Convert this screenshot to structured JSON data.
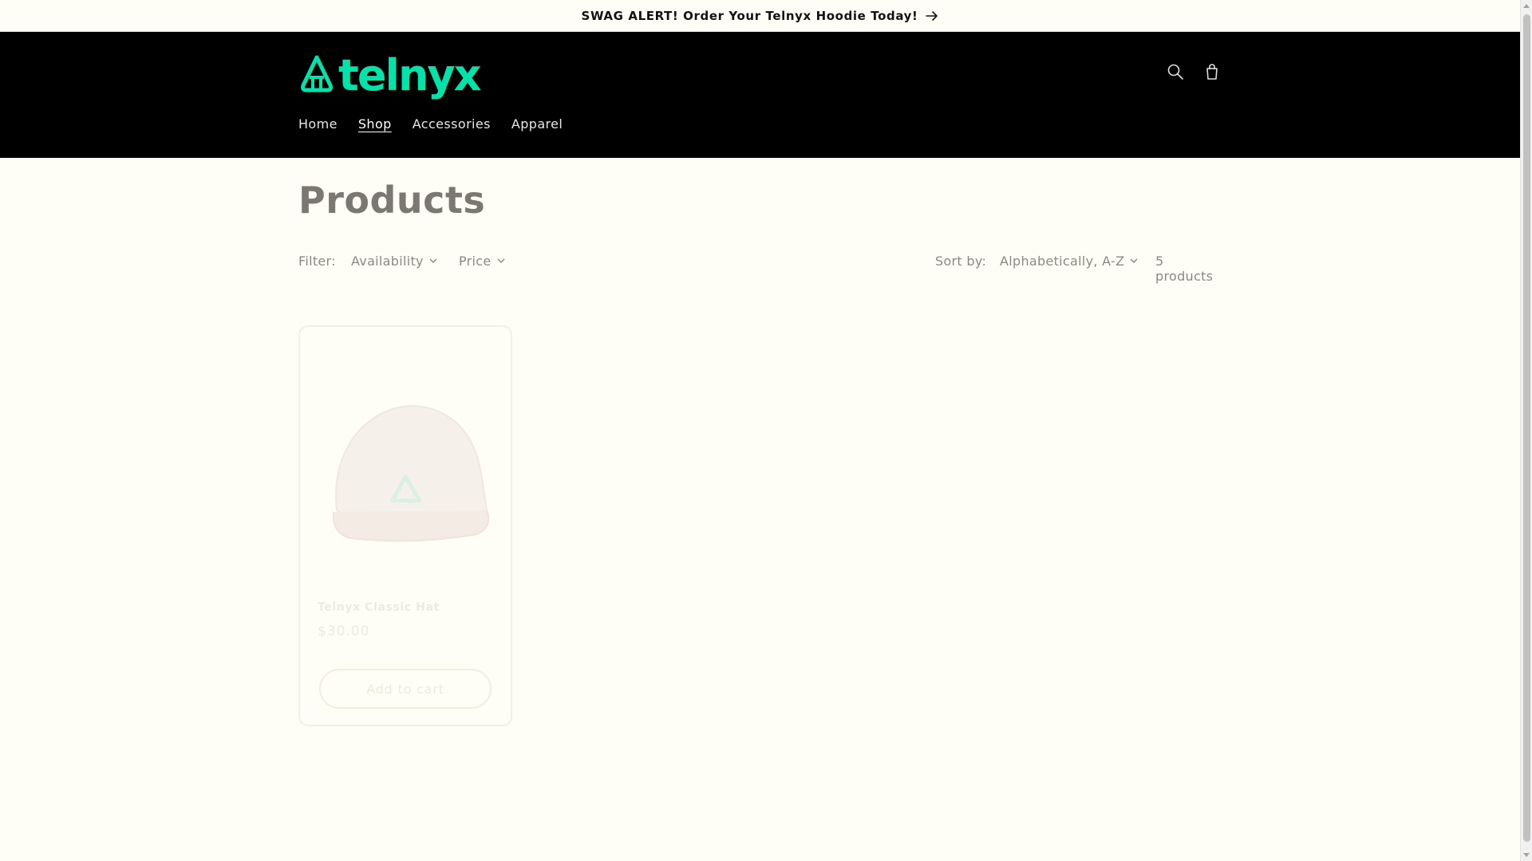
{
  "announcement": {
    "text": "SWAG ALERT! Order Your Telnyx Hoodie Today!",
    "icon": "arrow-right-icon"
  },
  "header": {
    "logo_text": "telnyx",
    "logo_color": "#00e3aa",
    "background": "#000000",
    "icons": [
      "search-icon",
      "cart-icon"
    ],
    "nav": [
      {
        "label": "Home",
        "active": false
      },
      {
        "label": "Shop",
        "active": true
      },
      {
        "label": "Accessories",
        "active": false
      },
      {
        "label": "Apparel",
        "active": false
      }
    ]
  },
  "page": {
    "title": "Products"
  },
  "filters": {
    "label": "Filter:",
    "availability": "Availability",
    "price": "Price",
    "sort_label": "Sort by:",
    "sort_value": "Alphabetically, A-Z",
    "count": "5 products"
  },
  "products": [
    {
      "title": "Telnyx Classic Hat",
      "price": "$30.00",
      "button": "Add to cart"
    }
  ]
}
